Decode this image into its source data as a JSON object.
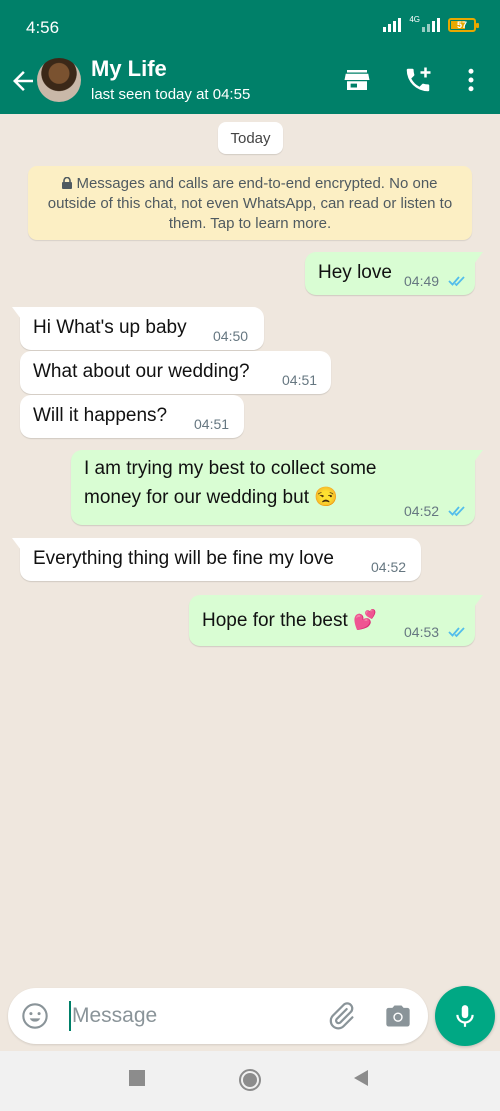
{
  "status_bar": {
    "time": "4:56",
    "network": "4G",
    "battery": "57"
  },
  "header": {
    "contact_name": "My Life",
    "contact_status": "last seen today at 04:55"
  },
  "chat": {
    "date_chip": "Today",
    "encryption_notice": "Messages and calls are end-to-end encrypted. No one outside of this chat, not even WhatsApp, can read or listen to them. Tap to learn more.",
    "messages": [
      {
        "direction": "out",
        "text": "Hey love",
        "time": "04:49",
        "read": true
      },
      {
        "direction": "in",
        "text": "Hi What's up baby",
        "time": "04:50"
      },
      {
        "direction": "in",
        "text": "What about our wedding?",
        "time": "04:51"
      },
      {
        "direction": "in",
        "text": "Will it happens?",
        "time": "04:51"
      },
      {
        "direction": "out",
        "text": "I am trying my best to collect some money for our wedding  but 😒",
        "time": "04:52",
        "read": true
      },
      {
        "direction": "in",
        "text": "Everything thing will be fine my love",
        "time": "04:52"
      },
      {
        "direction": "out",
        "text": "Hope for the best 💕",
        "time": "04:53",
        "read": true
      }
    ]
  },
  "composer": {
    "placeholder": "Message"
  },
  "colors": {
    "header": "#008069",
    "accent": "#00a884",
    "outgoing_bubble": "#d9fdd3",
    "incoming_bubble": "#ffffff",
    "read_ticks": "#53bdeb",
    "encryption_notice_bg": "#fcefc4",
    "chat_background": "#efe7de"
  },
  "icons": {
    "back": "arrow-left-icon",
    "store": "store-icon",
    "call_add": "add-call-icon",
    "menu": "more-vertical-icon",
    "emoji": "emoji-icon",
    "attach": "paperclip-icon",
    "camera": "camera-icon",
    "mic": "microphone-icon",
    "lock": "lock-icon",
    "read": "double-check-icon"
  }
}
